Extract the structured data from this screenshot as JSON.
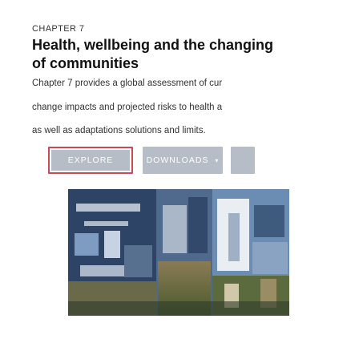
{
  "chapter": {
    "eyebrow": "CHAPTER 7",
    "title_line1": "Health, wellbeing and the changing",
    "title_line2": "of communities",
    "paragraph": [
      "Chapter 7 provides a global assessment of cur",
      "change impacts and projected risks to health a",
      "as well as adaptations solutions and limits."
    ]
  },
  "buttons": {
    "explore": "EXPLORE",
    "downloads": "DOWNLOADS",
    "downloads_caret": "▾"
  },
  "hero": {
    "icon": "photo-collage"
  },
  "colors": {
    "button_bg": "#b6bdc6",
    "focus_outline": "#c94a55"
  }
}
